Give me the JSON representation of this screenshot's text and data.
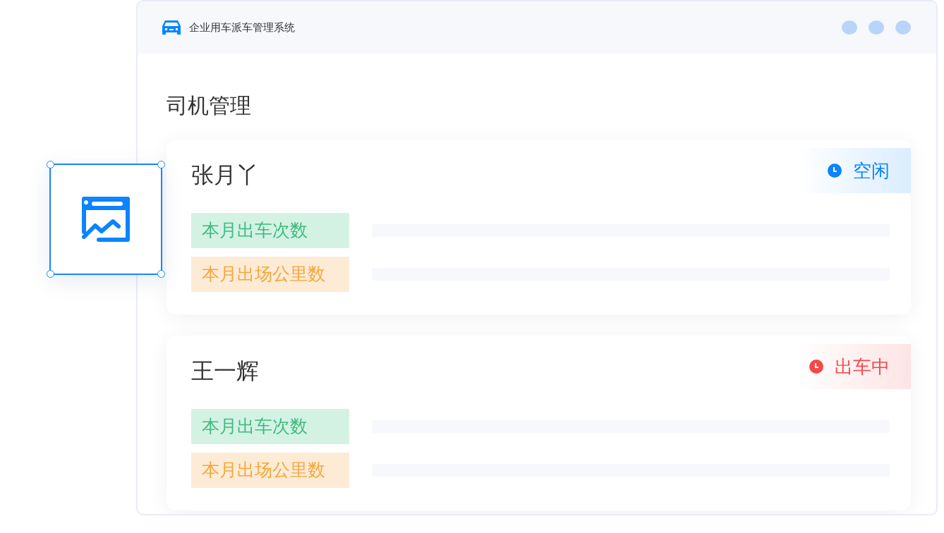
{
  "window": {
    "title": "企业用车派车管理系统"
  },
  "page_title": "司机管理",
  "drivers": [
    {
      "name": "张月丫",
      "status": {
        "label": "空闲",
        "color": "#0a84ff"
      },
      "stats": [
        {
          "label": "本月出车次数",
          "kind": "trips"
        },
        {
          "label": "本月出场公里数",
          "kind": "mileage"
        }
      ]
    },
    {
      "name": "王一辉",
      "status": {
        "label": "出车中",
        "color": "#f5484a"
      },
      "stats": [
        {
          "label": "本月出车次数",
          "kind": "trips"
        },
        {
          "label": "本月出场公里数",
          "kind": "mileage"
        }
      ]
    }
  ]
}
